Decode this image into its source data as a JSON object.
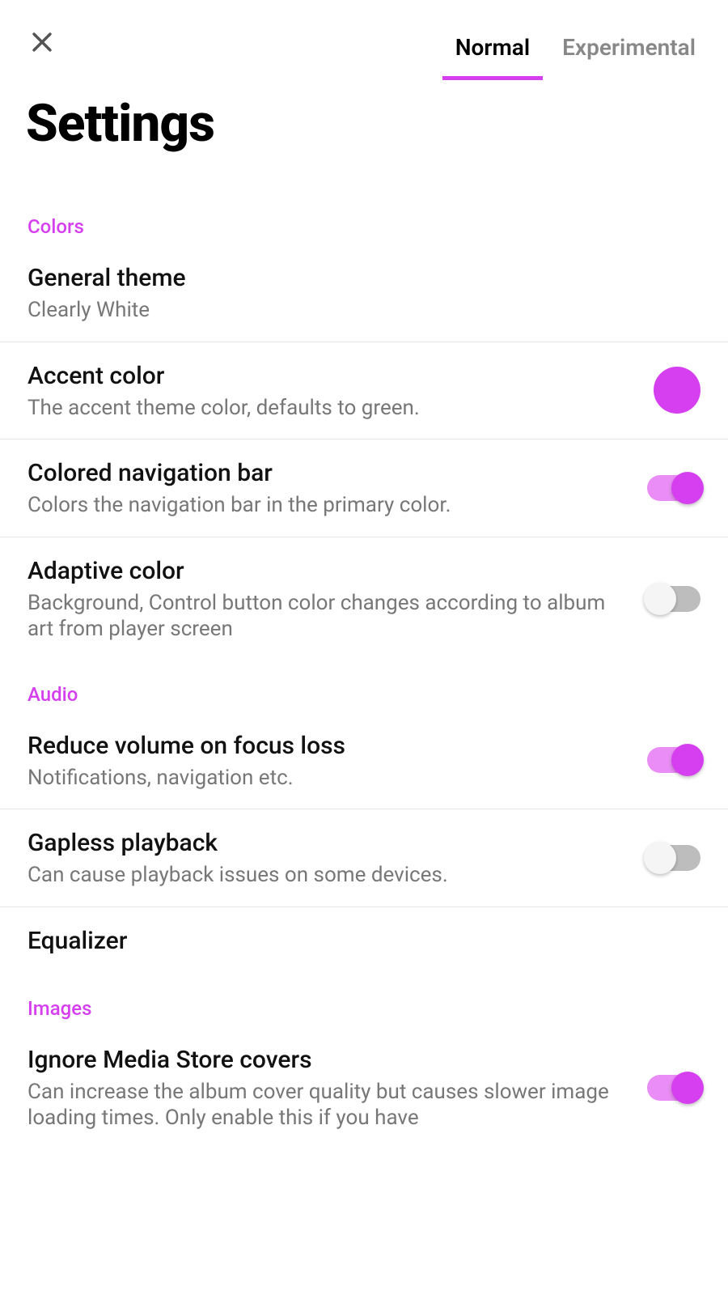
{
  "header": {
    "title": "Settings",
    "tabs": {
      "normal": "Normal",
      "experimental": "Experimental"
    }
  },
  "sections": {
    "colors": {
      "label": "Colors",
      "general_theme": {
        "title": "General theme",
        "sub": "Clearly White"
      },
      "accent_color": {
        "title": "Accent color",
        "sub": "The accent theme color, defaults to green.",
        "swatch": "#d63ff0"
      },
      "colored_nav": {
        "title": "Colored navigation bar",
        "sub": "Colors the navigation bar in the primary color.",
        "on": true
      },
      "adaptive": {
        "title": "Adaptive color",
        "sub": "Background, Control button color changes according to album art from player screen",
        "on": false
      }
    },
    "audio": {
      "label": "Audio",
      "reduce_volume": {
        "title": "Reduce volume on focus loss",
        "sub": "Notifications, navigation etc.",
        "on": true
      },
      "gapless": {
        "title": "Gapless playback",
        "sub": "Can cause playback issues on some devices.",
        "on": false
      },
      "equalizer": {
        "title": "Equalizer"
      }
    },
    "images": {
      "label": "Images",
      "ignore_mediastore": {
        "title": "Ignore Media Store covers",
        "sub": "Can increase the album cover quality but causes slower image loading times. Only enable this if you have",
        "on": true
      }
    }
  }
}
